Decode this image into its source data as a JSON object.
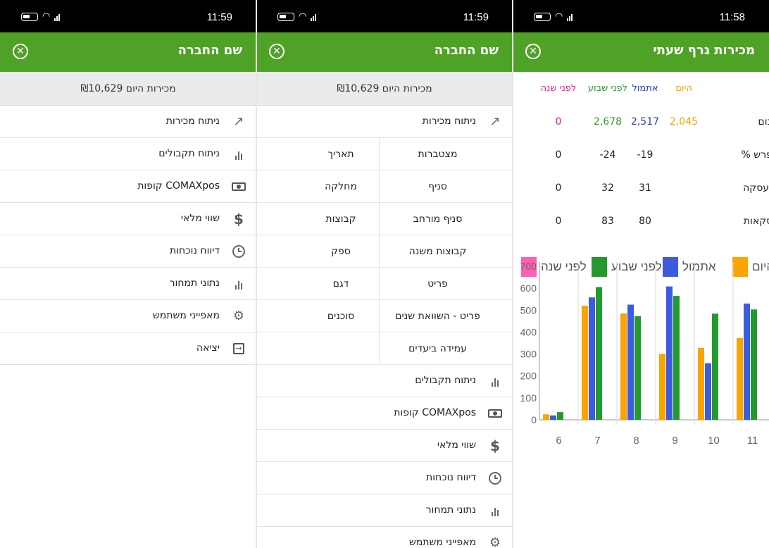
{
  "screens": [
    {
      "status_time": "11:59",
      "title": "שם החברה",
      "today_sales": "מכירות היום ₪10,629",
      "menu": [
        {
          "label": "ניתוח מכירות",
          "icon": "trending-up-icon"
        },
        {
          "label": "ניתוח תקבולים",
          "icon": "bar-chart-icon"
        },
        {
          "label": "קופות COMAXpos",
          "icon": "cash-register-icon"
        },
        {
          "label": "שווי מלאי",
          "icon": "dollar-icon"
        },
        {
          "label": "דיווח נוכחות",
          "icon": "alarm-clock-icon"
        },
        {
          "label": "נתוני תמחור",
          "icon": "bar-chart-icon"
        },
        {
          "label": "מאפייני משתמש",
          "icon": "gear-icon"
        },
        {
          "label": "יציאה",
          "icon": "exit-icon"
        }
      ]
    },
    {
      "status_time": "11:59",
      "title": "שם החברה",
      "today_sales": "מכירות היום ₪10,629",
      "expanded_item": "ניתוח מכירות",
      "submenu": [
        {
          "right": "מצטברות",
          "left": "תאריך"
        },
        {
          "right": "סניף",
          "left": "מחלקה"
        },
        {
          "right": "סניף מורחב",
          "left": "קבוצות"
        },
        {
          "right": "קבוצות משנה",
          "left": "ספק"
        },
        {
          "right": "פריט",
          "left": "דגם"
        },
        {
          "right": "פריט - השוואת שנים",
          "left": "סוכנים"
        },
        {
          "right": "עמידה ביעדים",
          "left": ""
        }
      ],
      "menu_after": [
        {
          "label": "ניתוח תקבולים",
          "icon": "bar-chart-icon"
        },
        {
          "label": "קופות COMAXpos",
          "icon": "cash-register-icon"
        },
        {
          "label": "שווי מלאי",
          "icon": "dollar-icon"
        },
        {
          "label": "דיווח נוכחות",
          "icon": "alarm-clock-icon"
        },
        {
          "label": "נתוני תמחור",
          "icon": "bar-chart-icon"
        },
        {
          "label": "מאפייני משתמש",
          "icon": "gear-icon"
        }
      ]
    },
    {
      "status_time": "11:58",
      "title": "מכירות גרף שעתי",
      "table": {
        "headers": [
          "היום",
          "אתמול",
          "לפני שבוע",
          "לפני שנה"
        ],
        "rows": [
          {
            "label": "סכום",
            "values": [
              "2,045",
              "2,517",
              "2,678",
              "0"
            ]
          },
          {
            "label": "% הפרש",
            "values": [
              "",
              "-19",
              "-24",
              "0"
            ]
          },
          {
            "label": "מ.עסקה",
            "values": [
              "",
              "31",
              "32",
              "0"
            ]
          },
          {
            "label": "עסקאות",
            "values": [
              "",
              "80",
              "83",
              "0"
            ]
          }
        ]
      },
      "colors": {
        "today": "#f9a400",
        "yesterday": "#3d5bde",
        "week_ago": "#24992f",
        "year_ago": "#ff5fb7"
      }
    }
  ],
  "chart_data": {
    "type": "bar",
    "categories": [
      "6",
      "7",
      "8",
      "9",
      "10",
      "11"
    ],
    "series": [
      {
        "name": "היום",
        "values": [
          25,
          520,
          485,
          300,
          328,
          373
        ]
      },
      {
        "name": "אתמול",
        "values": [
          20,
          558,
          525,
          608,
          258,
          530
        ]
      },
      {
        "name": "לפני שבוע",
        "values": [
          35,
          605,
          472,
          565,
          484,
          503
        ]
      },
      {
        "name": "לפני שנה",
        "values": [
          0,
          0,
          0,
          0,
          0,
          0
        ]
      }
    ],
    "ylim": [
      0,
      700
    ],
    "yticks": [
      "0",
      "100",
      "200",
      "300",
      "400",
      "500",
      "600",
      "700"
    ],
    "legend": "top",
    "grid": "vertical"
  }
}
